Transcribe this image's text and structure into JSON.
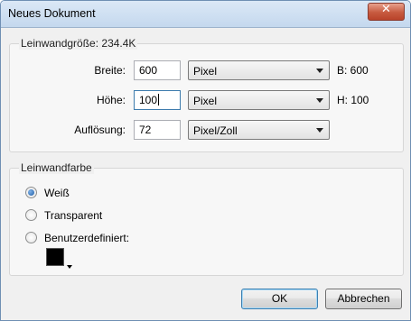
{
  "window": {
    "title": "Neues Dokument",
    "close_glyph": "✕",
    "close_icon": "close-icon"
  },
  "canvas_size": {
    "legend": "Leinwandgröße: 234.4K",
    "width": {
      "label": "Breite:",
      "value": "600",
      "unit": "Pixel",
      "readout": "B: 600"
    },
    "height": {
      "label": "Höhe:",
      "value": "100",
      "unit": "Pixel",
      "readout": "H: 100"
    },
    "resolution": {
      "label": "Auflösung:",
      "value": "72",
      "unit": "Pixel/Zoll"
    }
  },
  "canvas_color": {
    "legend": "Leinwandfarbe",
    "options": [
      {
        "label": "Weiß",
        "selected": true
      },
      {
        "label": "Transparent",
        "selected": false
      },
      {
        "label": "Benutzerdefiniert:",
        "selected": false
      }
    ],
    "custom_swatch_color": "#000000"
  },
  "buttons": {
    "ok": "OK",
    "cancel": "Abbrechen"
  }
}
